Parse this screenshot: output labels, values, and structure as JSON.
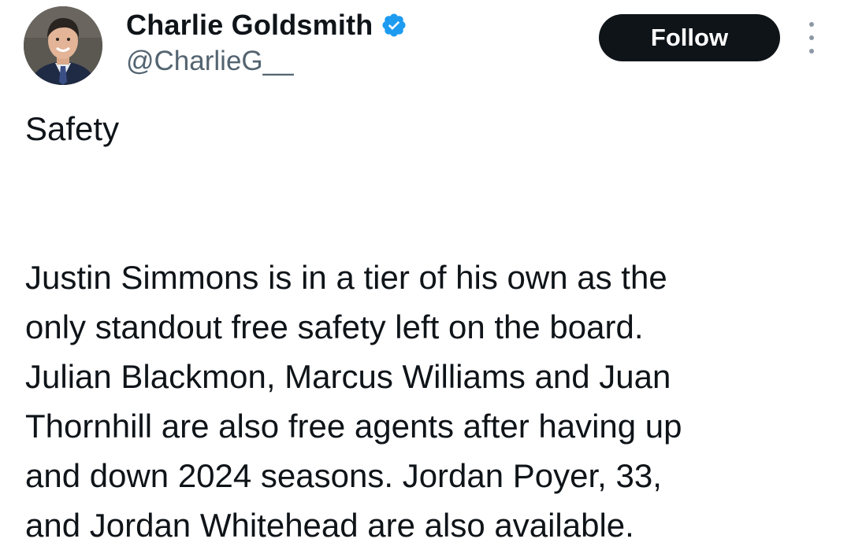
{
  "author": {
    "display_name": "Charlie Goldsmith",
    "handle": "@CharlieG__",
    "verified": true
  },
  "actions": {
    "follow_label": "Follow",
    "more_icon": "more-vertical-icon"
  },
  "tweet": {
    "heading": "Safety",
    "lines": [
      "Justin Simmons is in a tier of his own as the",
      "only standout free safety left on the board.",
      "Julian Blackmon, Marcus Williams and Juan",
      "Thornhill are also free agents after having up",
      "and down 2024 seasons. Jordan Poyer, 33,",
      "and Jordan Whitehead are also available."
    ]
  },
  "colors": {
    "text": "#0f1419",
    "secondary_text": "#536471",
    "verified_blue": "#1d9bf0",
    "follow_bg": "#0f1419"
  }
}
